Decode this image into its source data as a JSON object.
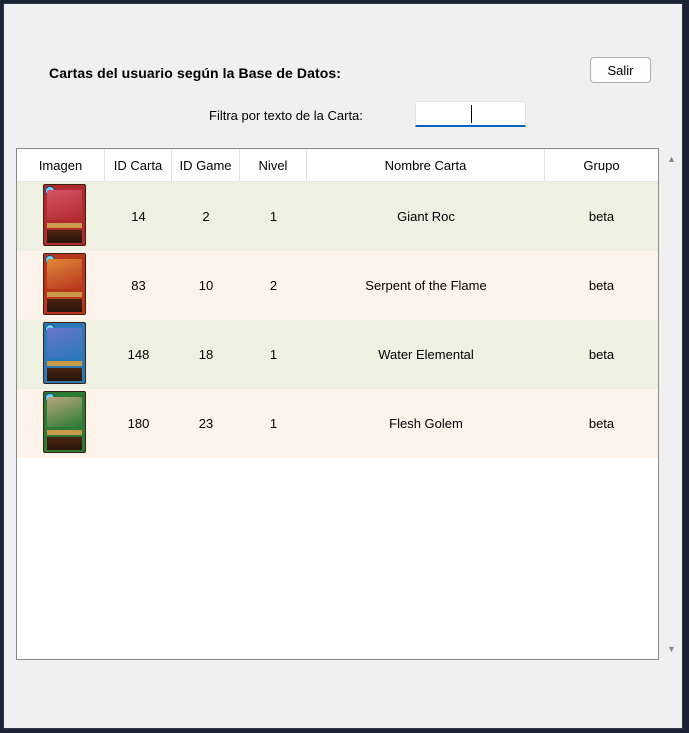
{
  "header": {
    "title": "Cartas del usuario según la Base de Datos:",
    "exit_label": "Salir"
  },
  "filter": {
    "label": "Filtra por texto de la Carta:",
    "value": ""
  },
  "table": {
    "columns": [
      "Imagen",
      "ID Carta",
      "ID Game",
      "Nivel",
      "Nombre Carta",
      "Grupo"
    ],
    "rows": [
      {
        "id_carta": "14",
        "id_game": "2",
        "nivel": "1",
        "nombre": "Giant Roc",
        "grupo": "beta",
        "card_color": "#b0292c",
        "art_color": "#d4556a"
      },
      {
        "id_carta": "83",
        "id_game": "10",
        "nivel": "2",
        "nombre": "Serpent of the Flame",
        "grupo": "beta",
        "card_color": "#b8361e",
        "art_color": "#e0873a"
      },
      {
        "id_carta": "148",
        "id_game": "18",
        "nivel": "1",
        "nombre": "Water Elemental",
        "grupo": "beta",
        "card_color": "#2a78b8",
        "art_color": "#6b76c9"
      },
      {
        "id_carta": "180",
        "id_game": "23",
        "nivel": "1",
        "nombre": "Flesh Golem",
        "grupo": "beta",
        "card_color": "#2c7a34",
        "art_color": "#b9a680"
      }
    ]
  },
  "icons": {
    "scroll_up": "triangle-up",
    "scroll_down": "triangle-down"
  },
  "colors": {
    "row_even": "#eef1e1",
    "row_odd": "#fdf3ea",
    "input_accent": "#0067c0"
  }
}
